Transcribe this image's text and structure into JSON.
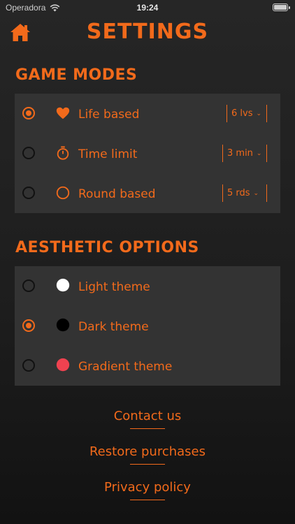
{
  "status_bar": {
    "carrier": "Operadora",
    "time": "19:24"
  },
  "header": {
    "title": "SETTINGS"
  },
  "game_modes": {
    "title": "GAME MODES",
    "items": [
      {
        "label": "Life based",
        "icon": "heart-icon",
        "selected": true,
        "value": "6 lvs"
      },
      {
        "label": "Time limit",
        "icon": "stopwatch-icon",
        "selected": false,
        "value": "3 min"
      },
      {
        "label": "Round based",
        "icon": "circle-icon",
        "selected": false,
        "value": "5 rds"
      }
    ]
  },
  "aesthetic_options": {
    "title": "AESTHETIC OPTIONS",
    "items": [
      {
        "label": "Light theme",
        "swatch": "#ffffff",
        "selected": false
      },
      {
        "label": "Dark theme",
        "swatch": "#000000",
        "selected": true
      },
      {
        "label": "Gradient theme",
        "swatch": "#ef4250",
        "selected": false
      }
    ]
  },
  "links": {
    "contact": "Contact us",
    "restore": "Restore purchases",
    "privacy": "Privacy policy"
  },
  "colors": {
    "accent": "#f26a1b",
    "panel": "#333333",
    "background": "#1f1f1f"
  }
}
